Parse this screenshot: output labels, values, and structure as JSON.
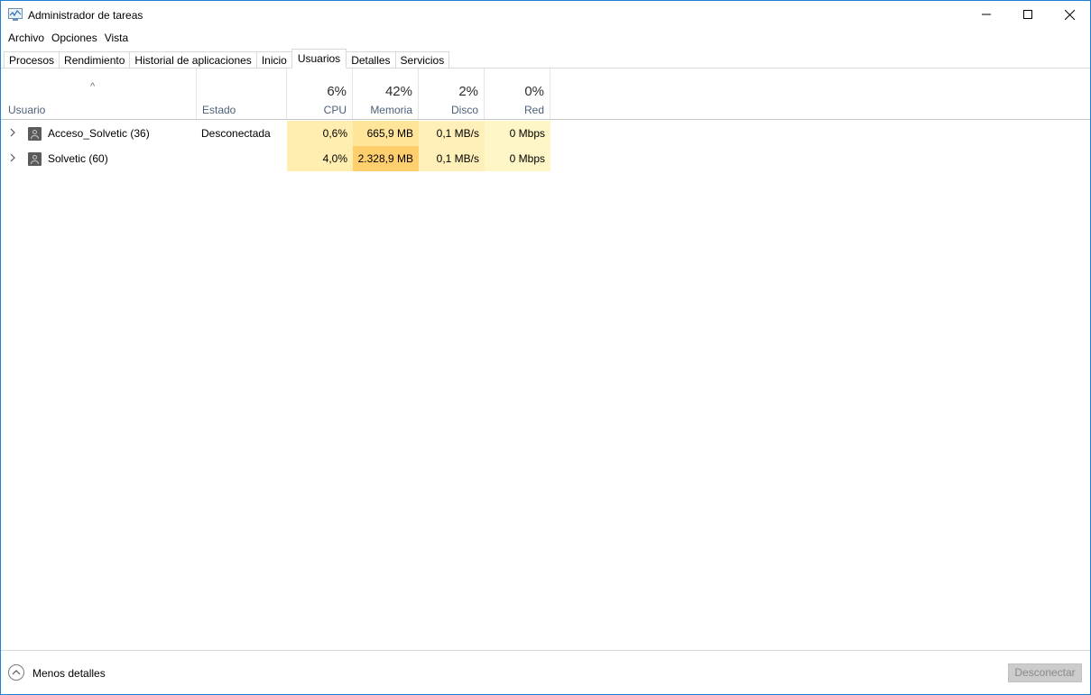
{
  "window": {
    "title": "Administrador de tareas"
  },
  "menu": [
    "Archivo",
    "Opciones",
    "Vista"
  ],
  "tabs": [
    {
      "label": "Procesos",
      "active": false
    },
    {
      "label": "Rendimiento",
      "active": false
    },
    {
      "label": "Historial de aplicaciones",
      "active": false
    },
    {
      "label": "Inicio",
      "active": false
    },
    {
      "label": "Usuarios",
      "active": true
    },
    {
      "label": "Detalles",
      "active": false
    },
    {
      "label": "Servicios",
      "active": false
    }
  ],
  "columns": {
    "usuario": "Usuario",
    "estado": "Estado",
    "cpu": {
      "pct": "6%",
      "label": "CPU"
    },
    "memoria": {
      "pct": "42%",
      "label": "Memoria"
    },
    "disco": {
      "pct": "2%",
      "label": "Disco"
    },
    "red": {
      "pct": "0%",
      "label": "Red"
    }
  },
  "rows": [
    {
      "name": "Acceso_Solvetic (36)",
      "estado": "Desconectada",
      "cpu": "0,6%",
      "memoria": "665,9 MB",
      "disco": "0,1 MB/s",
      "red": "0 Mbps"
    },
    {
      "name": "Solvetic (60)",
      "estado": "",
      "cpu": "4,0%",
      "memoria": "2.328,9 MB",
      "disco": "0,1 MB/s",
      "red": "0 Mbps"
    }
  ],
  "footer": {
    "less_details": "Menos detalles",
    "disconnect": "Desconectar"
  },
  "colors": {
    "heat_low": "#fff4c4",
    "heat_mid": "#ffe9a8",
    "heat_high": "#ffd27a",
    "accent_border": "#1e7fd6"
  }
}
